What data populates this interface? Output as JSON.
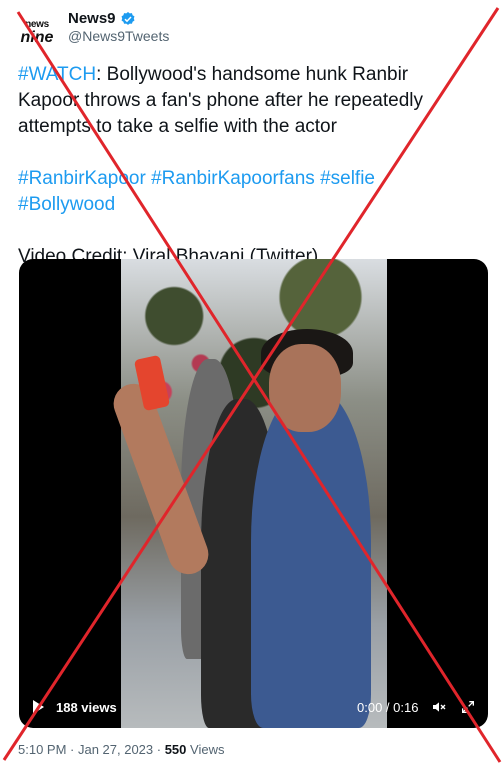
{
  "author": {
    "avatar_line1": "news",
    "avatar_line2": "nine",
    "display_name": "News9",
    "handle": "@News9Tweets"
  },
  "tweet": {
    "hashtag_watch": "#WATCH",
    "line1_rest": ": Bollywood's handsome hunk Ranbir",
    "line2": "Kapoor throws a fan's phone after he repeatedly",
    "line3": "attempts to take a selfie with the actor",
    "hashtags_line1": "#RanbirKapoor #RanbirKapoorfans #selfie",
    "hashtags_line2": "#Bollywood",
    "credit": "Video Credit: Viral Bhayani (Twitter)"
  },
  "video": {
    "views": "188 views",
    "time": "0:00 / 0:16",
    "icons": [
      "play-icon",
      "volume-icon",
      "fullscreen-icon"
    ]
  },
  "footer": {
    "timestamp": "5:10 PM · Jan 27, 2023 · ",
    "view_count": "550",
    "views_label": " Views"
  },
  "colors": {
    "link": "#1d9bf0",
    "overlay_x": "#e0252b",
    "verified": "#1d9bf0"
  }
}
